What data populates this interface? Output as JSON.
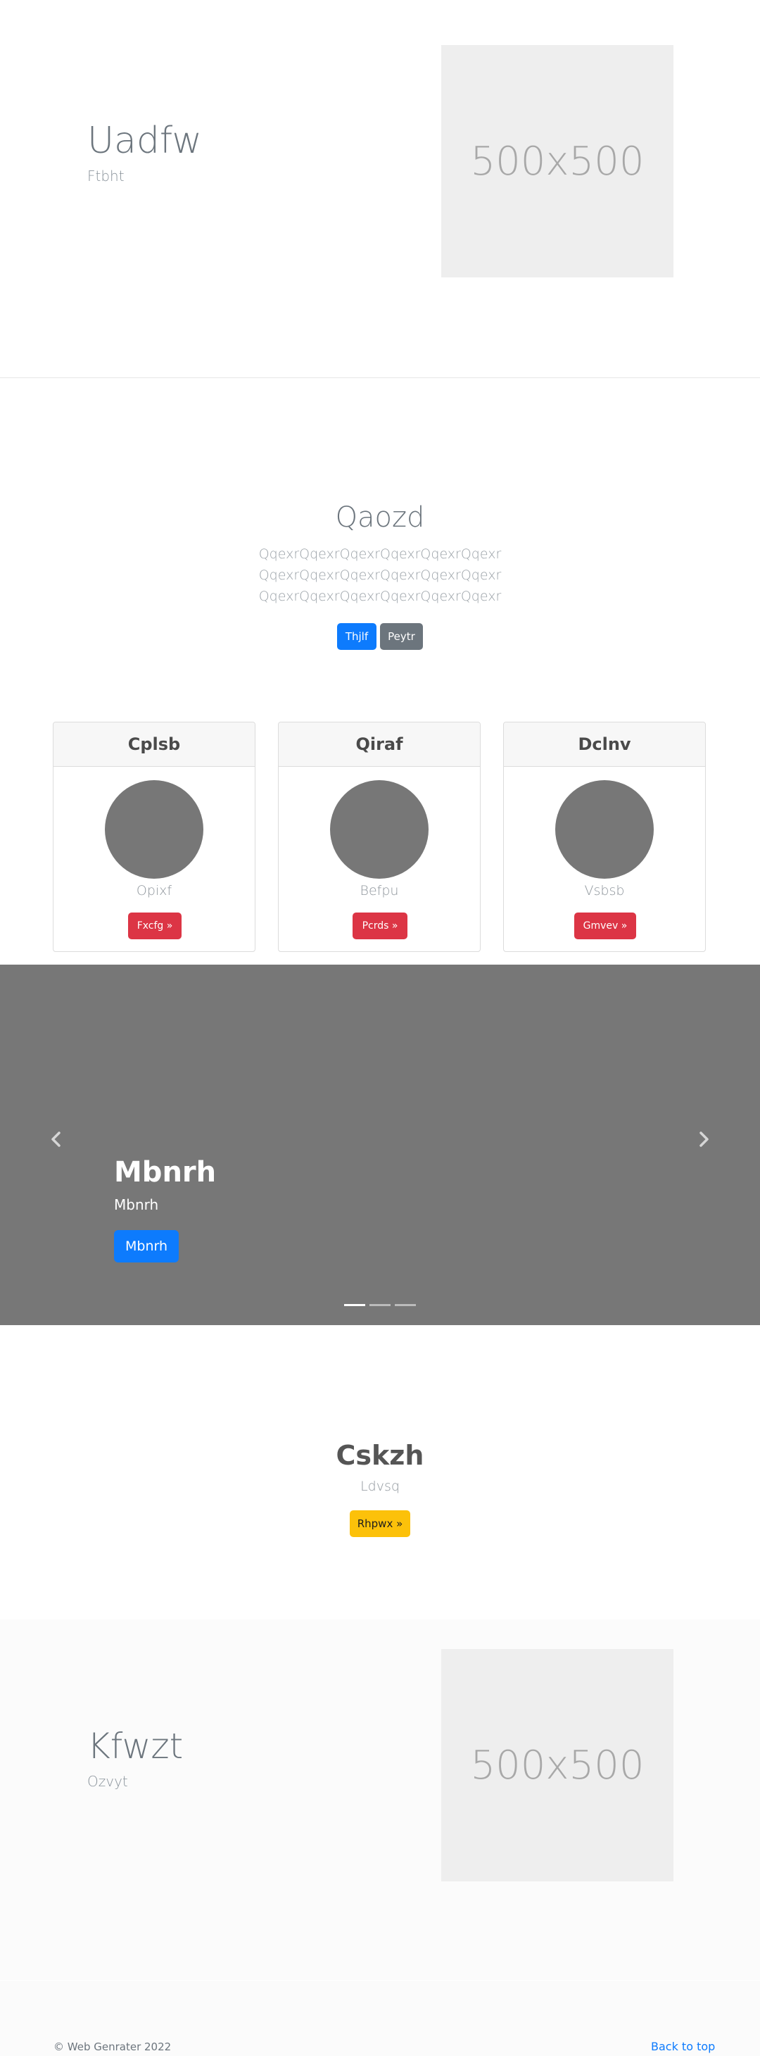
{
  "hero1": {
    "title": "Uadfw",
    "subtitle": "Ftbht",
    "image_label": "500x500"
  },
  "intro": {
    "title": "Qaozd",
    "lines": [
      "QqexrQqexrQqexrQqexrQqexrQqexr",
      "QqexrQqexrQqexrQqexrQqexrQqexr",
      "QqexrQqexrQqexrQqexrQqexrQqexr"
    ],
    "primary_button": "Thjlf",
    "secondary_button": "Peytr"
  },
  "cards": [
    {
      "header": "Cplsb",
      "text": "Opixf",
      "button": "Fxcfg »"
    },
    {
      "header": "Qiraf",
      "text": "Befpu",
      "button": "Pcrds »"
    },
    {
      "header": "Dclnv",
      "text": "Vsbsb",
      "button": "Gmvev »"
    }
  ],
  "carousel": {
    "title": "Mbnrh",
    "subtitle": "Mbnrh",
    "button": "Mbnrh",
    "indicators": 3,
    "active_index": 0,
    "prev_icon": "chevron-left-icon",
    "next_icon": "chevron-right-icon"
  },
  "section4": {
    "title": "Cskzh",
    "subtitle": "Ldvsq",
    "button": "Rhpwx »"
  },
  "hero2": {
    "title": "Kfwzt",
    "subtitle": "Ozvyt",
    "image_label": "500x500"
  },
  "footer": {
    "copyright": "© Web Genrater 2022",
    "back_to_top": "Back to top"
  },
  "colors": {
    "primary": "#0d7bfd",
    "secondary": "#6c757d",
    "danger": "#dc3545",
    "warning": "#fcc10a",
    "placeholder": "#eeeeee",
    "carousel_bg": "#777777"
  }
}
